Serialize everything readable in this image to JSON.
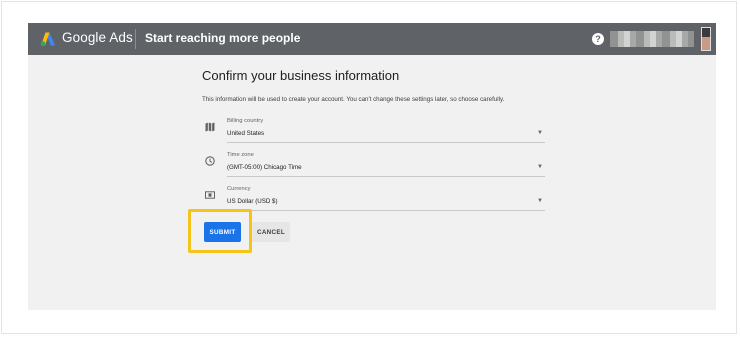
{
  "header": {
    "brand": "Google Ads",
    "page_title": "Start reaching more people",
    "help_glyph": "?",
    "brand_colors": {
      "blue": "#4285f4",
      "yellow": "#fbbc04",
      "green": "#34a853"
    },
    "bar_color": "#5f6368"
  },
  "form": {
    "title": "Confirm your business information",
    "intro": "This information will be used to create your account. You can't change these settings later, so choose carefully.",
    "fields": [
      {
        "icon": "map-icon",
        "label": "Billing country",
        "value": "United States"
      },
      {
        "icon": "clock-icon",
        "label": "Time zone",
        "value": "(GMT-05:00) Chicago Time"
      },
      {
        "icon": "currency-icon",
        "label": "Currency",
        "value": "US Dollar (USD $)"
      }
    ],
    "caret_glyph": "▼"
  },
  "actions": {
    "submit_label": "SUBMIT",
    "cancel_label": "CANCEL",
    "accent_color": "#1a73e8",
    "highlight_color": "#f4c518"
  }
}
